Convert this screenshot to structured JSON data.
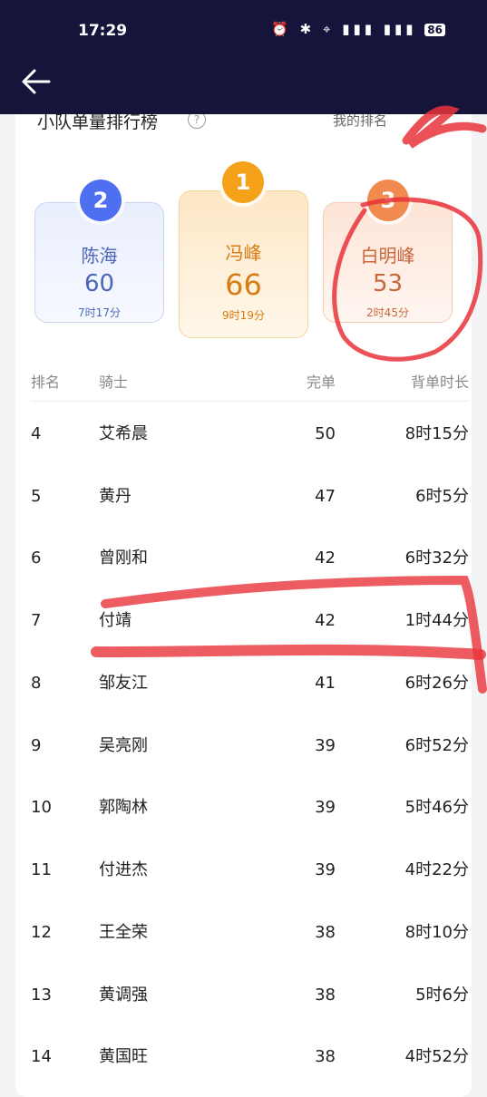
{
  "status": {
    "time": "17:29",
    "icons": "⏰ ✱ ⌖ ▮▮▮ ▮▮▮",
    "battery": "86"
  },
  "header": {
    "back_icon": "back-arrow-icon"
  },
  "card": {
    "title": "小队单量排行榜",
    "help_icon": "?",
    "my_rank_label": "我的排名"
  },
  "podium": [
    {
      "rank": "2",
      "name": "陈海",
      "count": "60",
      "time": "7时17分",
      "color": "#4e6ff0"
    },
    {
      "rank": "1",
      "name": "冯峰",
      "count": "66",
      "time": "9时19分",
      "color": "#f5a11a"
    },
    {
      "rank": "3",
      "name": "白明峰",
      "count": "53",
      "time": "2时45分",
      "color": "#f08a4e"
    }
  ],
  "table": {
    "headers": {
      "rank": "排名",
      "rider": "骑士",
      "done": "完单",
      "time": "背单时长"
    },
    "rows": [
      {
        "rank": "4",
        "name": "艾希晨",
        "done": "50",
        "time": "8时15分"
      },
      {
        "rank": "5",
        "name": "黄丹",
        "done": "47",
        "time": "6时5分"
      },
      {
        "rank": "6",
        "name": "曾刚和",
        "done": "42",
        "time": "6时32分"
      },
      {
        "rank": "7",
        "name": "付靖",
        "done": "42",
        "time": "1时44分"
      },
      {
        "rank": "8",
        "name": "邹友江",
        "done": "41",
        "time": "6时26分"
      },
      {
        "rank": "9",
        "name": "吴亮刚",
        "done": "39",
        "time": "6时52分"
      },
      {
        "rank": "10",
        "name": "郭陶林",
        "done": "39",
        "time": "5时46分"
      },
      {
        "rank": "11",
        "name": "付进杰",
        "done": "39",
        "time": "4时22分"
      },
      {
        "rank": "12",
        "name": "王全荣",
        "done": "38",
        "time": "8时10分"
      },
      {
        "rank": "13",
        "name": "黄调强",
        "done": "38",
        "time": "5时6分"
      },
      {
        "rank": "14",
        "name": "黄国旺",
        "done": "38",
        "time": "4时52分"
      }
    ]
  },
  "colors": {
    "topbar": "#16143a",
    "annotation": "#e8333a"
  }
}
